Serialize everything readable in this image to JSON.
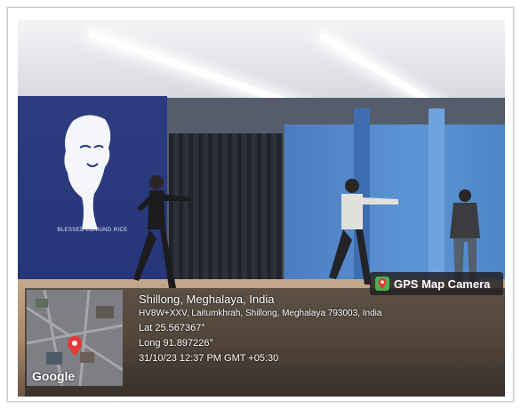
{
  "photo": {
    "banner_caption": "BLESSED EDMUND RICE"
  },
  "overlay": {
    "badge": {
      "icon": "map-pin-icon",
      "label": "GPS Map Camera"
    },
    "map": {
      "label": "Google"
    },
    "location": "Shillong, Meghalaya, India",
    "address": "HV8W+XXV, Laitumkhrah, Shillong, Meghalaya 793003, India",
    "latitude": "Lat 25.567367°",
    "longitude": "Long 91.897226°",
    "timestamp": "31/10/23 12:37 PM GMT +05:30"
  }
}
